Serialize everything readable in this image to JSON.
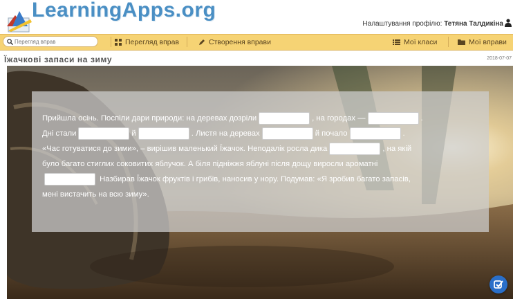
{
  "header": {
    "logo_text": "LearningApps.org",
    "profile_settings": "Налаштування профілю:",
    "user_name": "Тетяна Талдикіна"
  },
  "nav": {
    "search_placeholder": "Перегляд вправ",
    "browse": "Перегляд вправ",
    "create": "Створення вправи",
    "classes": "Мої класи",
    "my_apps": "Мої вправи"
  },
  "title_row": {
    "title": "Їжачкові запаси на зиму",
    "date": "2018-07-07"
  },
  "exercise": {
    "p1": "Прийшла осінь. Поспіли дари природи: на деревах дозріли",
    "p2": ", на городах —",
    "p3": ".",
    "p4": "Дні стали",
    "p5": "й",
    "p6": ". Листя на деревах",
    "p7": "й почало",
    "p8": ".",
    "p9": "«Час готуватися до зими», – вирішив маленький Їжачок. Неподалік росла дика",
    "p10": ", на якій",
    "p11": "було багато стиглих соковитих яблучок. А біля підніжжя яблуні після дощу виросли ароматні",
    "p12": "Назбирав Їжачок фруктів і грибів, наносив у нору. Подумав: «Я зробив багато запасів,",
    "p13": "мені вистачить на всю зиму»."
  },
  "colors": {
    "nav_bg": "#f6d374",
    "logo_blue": "#4a8fc4",
    "check_button": "#2a6fc9"
  },
  "icons": {
    "search": "search-icon",
    "browse": "grid-icon",
    "create": "pencil-icon",
    "classes": "list-icon",
    "my_apps": "folder-icon",
    "user": "user-icon",
    "check": "check-icon"
  }
}
